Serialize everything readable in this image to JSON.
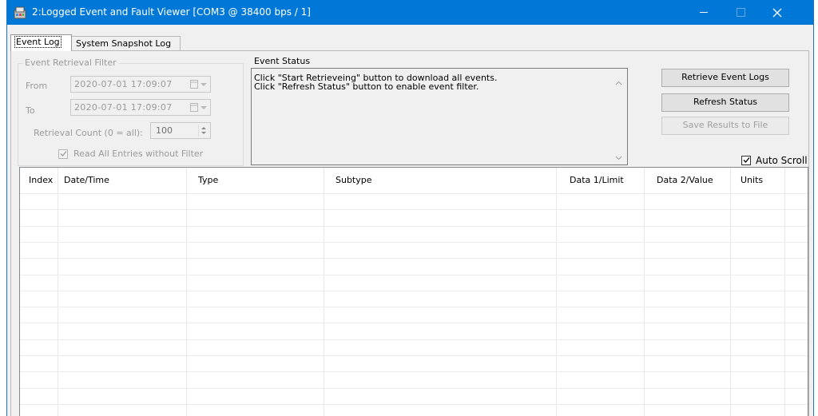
{
  "window": {
    "title": "2:Logged Event and Fault Viewer [COM3 @ 38400 bps / 1]",
    "accent": "#0078d7"
  },
  "tabs": [
    {
      "label": "Event Log",
      "active": true
    },
    {
      "label": "System Snapshot Log",
      "active": false
    }
  ],
  "filter": {
    "legend": "Event Retrieval Filter",
    "from_label": "From",
    "from_value": "2020-07-01  17:09:07",
    "to_label": "To",
    "to_value": "2020-07-01  17:09:07",
    "count_label": "Retrieval Count (0 = all):",
    "count_value": "100",
    "read_all_label": "Read All Entries without Filter",
    "read_all_checked": true
  },
  "status": {
    "legend": "Event Status",
    "lines": [
      "Click \"Start Retrieveing\" button to download all events.",
      "Click \"Refresh Status\" button to enable event filter."
    ]
  },
  "buttons": {
    "retrieve": "Retrieve Event Logs",
    "refresh": "Refresh Status",
    "save": "Save Results to File"
  },
  "auto_scroll": {
    "label": "Auto Scroll",
    "checked": true
  },
  "grid": {
    "columns": [
      "Index",
      "Date/Time",
      "Type",
      "Subtype",
      "Data 1/Limit",
      "Data 2/Value",
      "Units"
    ],
    "rows": []
  }
}
